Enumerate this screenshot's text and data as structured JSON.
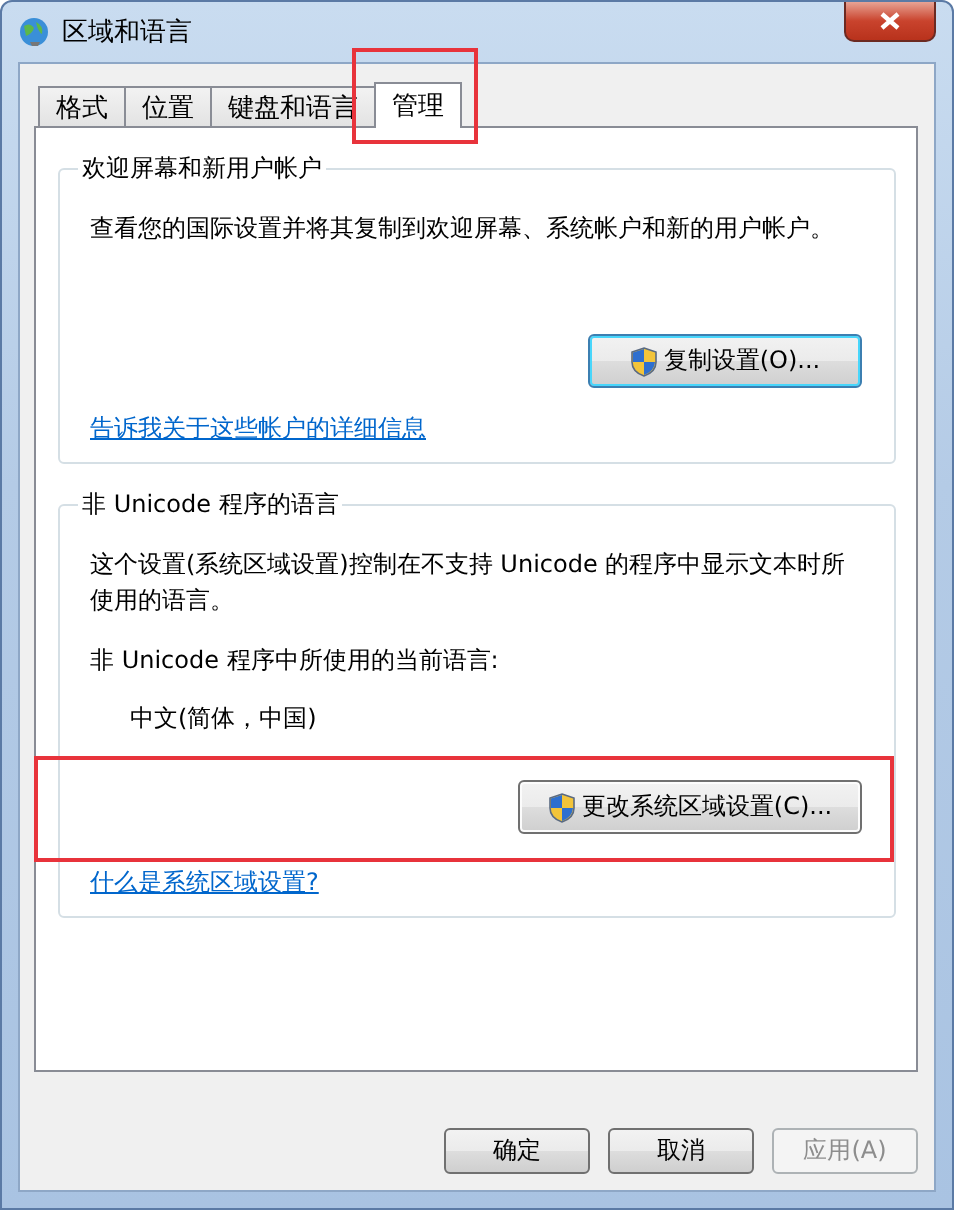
{
  "window": {
    "title": "区域和语言"
  },
  "tabs": [
    {
      "label": "格式",
      "selected": false,
      "highlighted": false
    },
    {
      "label": "位置",
      "selected": false,
      "highlighted": false
    },
    {
      "label": "键盘和语言",
      "selected": false,
      "highlighted": false
    },
    {
      "label": "管理",
      "selected": true,
      "highlighted": true
    }
  ],
  "groups": [
    {
      "title": "欢迎屏幕和新用户帐户",
      "lines": [
        {
          "kind": "text",
          "text": "查看您的国际设置并将其复制到欢迎屏幕、系统帐户和新的用户帐户。"
        }
      ],
      "button": {
        "label": "复制设置(O)...",
        "focused": true,
        "highlighted": false
      },
      "link": "告诉我关于这些帐户的详细信息"
    },
    {
      "title": "非 Unicode 程序的语言",
      "lines": [
        {
          "kind": "text",
          "text": "这个设置(系统区域设置)控制在不支持 Unicode 的程序中显示文本时所使用的语言。"
        },
        {
          "kind": "text",
          "text": "非 Unicode 程序中所使用的当前语言:"
        },
        {
          "kind": "value",
          "text": "中文(简体，中国)"
        }
      ],
      "button": {
        "label": "更改系统区域设置(C)...",
        "focused": false,
        "highlighted": true
      },
      "link": "什么是系统区域设置?"
    }
  ],
  "buttons": [
    {
      "label": "确定",
      "disabled": false
    },
    {
      "label": "取消",
      "disabled": false
    },
    {
      "label": "应用(A)",
      "disabled": true
    }
  ]
}
